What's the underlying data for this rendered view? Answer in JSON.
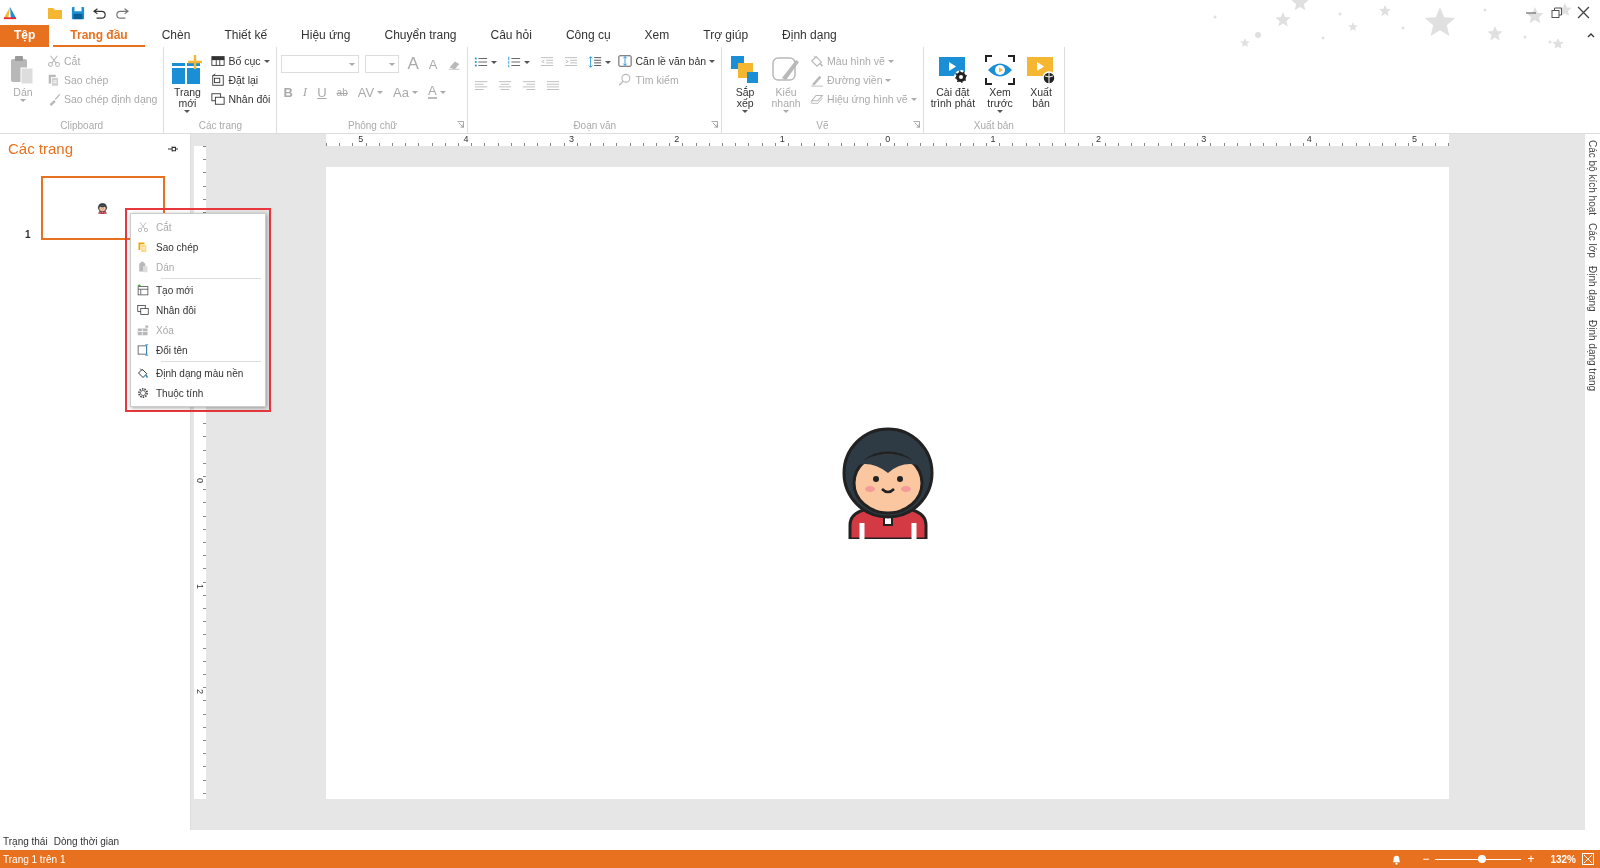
{
  "ribbon_tabs": [
    {
      "label": "Tệp",
      "kind": "file",
      "selected": false
    },
    {
      "label": "Trang đầu",
      "kind": "tab",
      "selected": true
    },
    {
      "label": "Chèn",
      "kind": "tab",
      "selected": false
    },
    {
      "label": "Thiết kế",
      "kind": "tab",
      "selected": false
    },
    {
      "label": "Hiệu ứng",
      "kind": "tab",
      "selected": false
    },
    {
      "label": "Chuyển trang",
      "kind": "tab",
      "selected": false
    },
    {
      "label": "Câu hỏi",
      "kind": "tab",
      "selected": false
    },
    {
      "label": "Công cụ",
      "kind": "tab",
      "selected": false
    },
    {
      "label": "Xem",
      "kind": "tab",
      "selected": false
    },
    {
      "label": "Trợ giúp",
      "kind": "tab",
      "selected": false
    },
    {
      "label": "Định dạng",
      "kind": "tab",
      "selected": false
    }
  ],
  "ribbon_groups": [
    {
      "label": "Clipboard",
      "launcher": false,
      "items": [
        {
          "kind": "large",
          "label": "Dán",
          "disabled": true,
          "dropdown": true
        },
        {
          "kind": "small",
          "label": "Cắt",
          "disabled": true,
          "dropdown": false
        },
        {
          "kind": "small",
          "label": "Sao chép",
          "disabled": true,
          "dropdown": false
        },
        {
          "kind": "small",
          "label": "Sao chép định dạng",
          "disabled": true,
          "dropdown": false
        }
      ]
    },
    {
      "label": "Các trang",
      "launcher": false,
      "items": [
        {
          "kind": "large",
          "label": "Trang\nmới",
          "disabled": false,
          "dropdown": true
        },
        {
          "kind": "small",
          "label": "Bố cục",
          "disabled": false,
          "dropdown": true
        },
        {
          "kind": "small",
          "label": "Đặt lại",
          "disabled": false,
          "dropdown": false
        },
        {
          "kind": "small",
          "label": "Nhân đôi",
          "disabled": false,
          "dropdown": false
        }
      ]
    },
    {
      "label": "Phông chữ",
      "launcher": true,
      "items": [
        {
          "kind": "panel",
          "rows": [
            {
              "items": [
                {
                  "kind": "combo",
                  "disabled": true,
                  "dropdown": true
                },
                {
                  "kind": "combo-small",
                  "disabled": true,
                  "dropdown": true
                },
                {
                  "kind": "glyph-large",
                  "label": "A",
                  "disabled": true,
                  "dropdown": false
                },
                {
                  "kind": "glyph-small",
                  "label": "A",
                  "disabled": true,
                  "dropdown": false
                },
                {
                  "kind": "icon",
                  "disabled": true,
                  "dropdown": false
                }
              ]
            },
            {
              "items": [
                {
                  "kind": "glyph",
                  "label": "B",
                  "disabled": true,
                  "dropdown": false
                },
                {
                  "kind": "glyph",
                  "label": "I",
                  "disabled": true,
                  "dropdown": false
                },
                {
                  "kind": "glyph",
                  "label": "U",
                  "disabled": true,
                  "dropdown": false
                },
                {
                  "kind": "glyph",
                  "label": "ab",
                  "disabled": true,
                  "dropdown": false
                },
                {
                  "kind": "glyph",
                  "label": "AV",
                  "disabled": true,
                  "dropdown": true
                },
                {
                  "kind": "glyph",
                  "label": "Aa",
                  "disabled": true,
                  "dropdown": true
                },
                {
                  "kind": "glyph",
                  "label": "A",
                  "disabled": true,
                  "dropdown": true
                }
              ]
            }
          ]
        }
      ]
    },
    {
      "label": "Đoạn văn",
      "launcher": true,
      "items": [
        {
          "kind": "panel",
          "rows": [
            {
              "items": [
                {
                  "kind": "icon",
                  "disabled": false,
                  "dropdown": true
                },
                {
                  "kind": "icon",
                  "disabled": false,
                  "dropdown": true
                },
                {
                  "kind": "icon",
                  "disabled": true,
                  "dropdown": false
                },
                {
                  "kind": "icon",
                  "disabled": true,
                  "dropdown": false
                },
                {
                  "kind": "icon",
                  "disabled": false,
                  "dropdown": true
                }
              ]
            },
            {
              "items": [
                {
                  "kind": "icon",
                  "disabled": true,
                  "dropdown": false
                },
                {
                  "kind": "icon",
                  "disabled": true,
                  "dropdown": false
                },
                {
                  "kind": "icon",
                  "disabled": true,
                  "dropdown": false
                },
                {
                  "kind": "icon",
                  "disabled": true,
                  "dropdown": false
                }
              ]
            }
          ]
        },
        {
          "kind": "small",
          "label": "Căn lề văn bản",
          "disabled": false,
          "dropdown": true
        },
        {
          "kind": "small",
          "label": "Tìm kiếm",
          "disabled": true,
          "dropdown": false
        }
      ]
    },
    {
      "label": "Vẽ",
      "launcher": true,
      "items": [
        {
          "kind": "large",
          "label": "Sắp\nxếp",
          "disabled": false,
          "dropdown": true
        },
        {
          "kind": "large",
          "label": "Kiểu\nnhanh",
          "disabled": true,
          "dropdown": true
        },
        {
          "kind": "small",
          "label": "Màu hình vẽ",
          "disabled": true,
          "dropdown": true
        },
        {
          "kind": "small",
          "label": "Đường viền",
          "disabled": true,
          "dropdown": true
        },
        {
          "kind": "small",
          "label": "Hiệu ứng hình vẽ",
          "disabled": true,
          "dropdown": true
        }
      ]
    },
    {
      "label": "Xuất bản",
      "launcher": false,
      "items": [
        {
          "kind": "large",
          "label": "Cài đặt\ntrình phát",
          "disabled": false,
          "dropdown": false
        },
        {
          "kind": "large",
          "label": "Xem\ntrước",
          "disabled": false,
          "dropdown": true
        },
        {
          "kind": "large",
          "label": "Xuất\nbản",
          "disabled": false,
          "dropdown": false
        }
      ]
    }
  ],
  "pages_panel": {
    "title": "Các trang",
    "pages": [
      {
        "number": "1",
        "selected": true
      }
    ]
  },
  "context_menu": {
    "highlighted": true,
    "items": [
      {
        "kind": "item",
        "label": "Cắt",
        "disabled": true
      },
      {
        "kind": "item",
        "label": "Sao chép",
        "disabled": false
      },
      {
        "kind": "item",
        "label": "Dán",
        "disabled": true
      },
      {
        "kind": "separator"
      },
      {
        "kind": "item",
        "label": "Tạo mới",
        "disabled": false
      },
      {
        "kind": "item",
        "label": "Nhân đôi",
        "disabled": false
      },
      {
        "kind": "item",
        "label": "Xóa",
        "disabled": true
      },
      {
        "kind": "item",
        "label": "Đổi tên",
        "disabled": false
      },
      {
        "kind": "separator"
      },
      {
        "kind": "item",
        "label": "Định dạng màu nền",
        "disabled": false
      },
      {
        "kind": "item",
        "label": "Thuộc tính",
        "disabled": false
      }
    ]
  },
  "rulers": {
    "horizontal": [
      "5",
      "4",
      "3",
      "2",
      "1",
      "0",
      "1",
      "2",
      "3",
      "4",
      "5"
    ],
    "vertical": [
      "0",
      "1",
      "2"
    ]
  },
  "side_tabs": [
    "Các bộ kích hoạt",
    "Các lớp",
    "Định dạng",
    "Định dạng trang"
  ],
  "timeline_tabs": [
    "Trạng thái",
    "Dòng thời gian"
  ],
  "status_bar": {
    "page_info": "Trang 1 trên 1",
    "zoom_out": "−",
    "zoom_in": "+",
    "zoom": {
      "level": 0.54
    },
    "zoom_value": "132%"
  }
}
